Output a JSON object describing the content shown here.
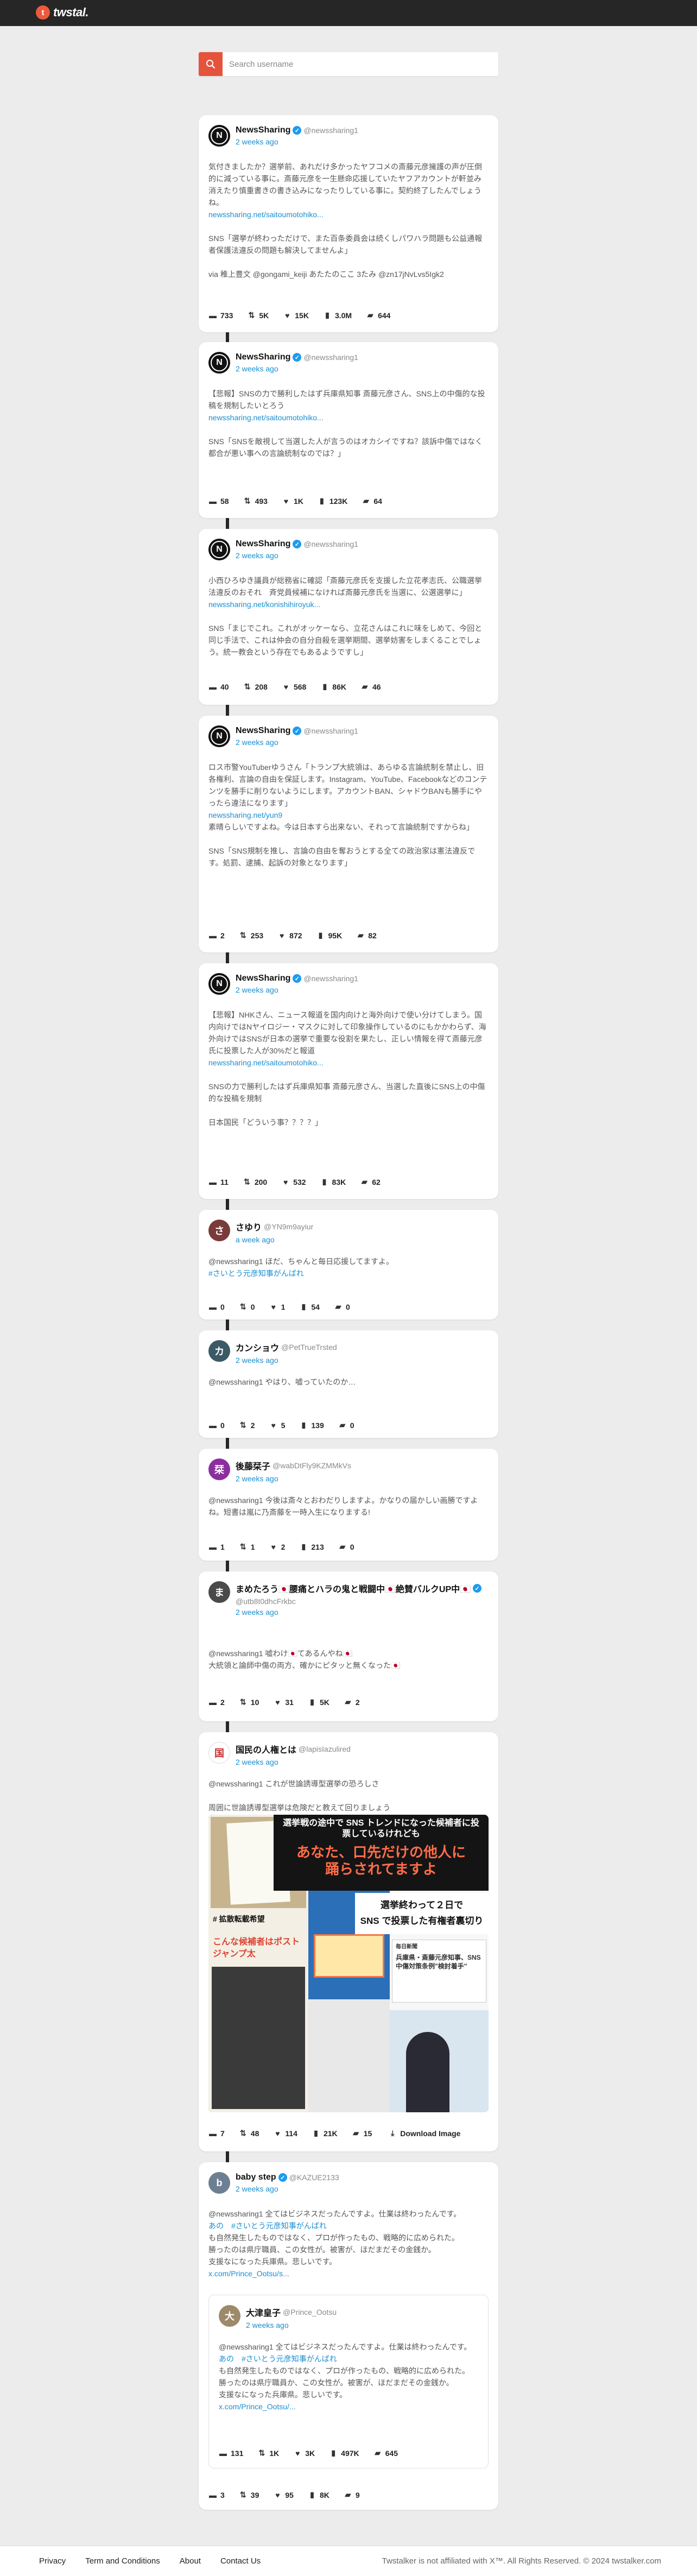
{
  "app": {
    "logo_text": "twstal."
  },
  "search": {
    "placeholder": "Search username"
  },
  "colors": {
    "accent": "#e5533d",
    "link": "#1a8fd1",
    "verified": "#1d9bf0",
    "topbar": "#262626"
  },
  "posts": [
    {
      "name": "NewsSharing",
      "handle": "@newssharing1",
      "time": "2 weeks ago",
      "body": [
        "気付きましたか？選挙前、あれだけ多かったヤフコメの斎藤元彦擁護の声が圧倒的に減っている事に。斎藤元彦を一生懸命応援していたヤフアカウントが軒並み消えたり慎重書きの書き込みになったりしている事に。契約終了したんでしょうね。",
        "newssharing.net/saitoumotohiko...",
        "",
        "SNS「選挙が終わっただけで、また百条委員会は続くしパワハラ問題も公益通報者保護法違反の問題も解決してませんよ」",
        "",
        "via 稚上豊文 @gongami_keiji あたたのここ 3たみ @zn17jNvLvs5Igk2"
      ],
      "stats": {
        "comments": "733",
        "reposts": "5K",
        "likes": "15K",
        "views": "3.0M",
        "bookmarks": "644"
      }
    },
    {
      "name": "NewsSharing",
      "handle": "@newssharing1",
      "time": "2 weeks ago",
      "body": [
        "【悲報】SNSの力で勝利したはず兵庫県知事 斎藤元彦さん、SNS上の中傷的な投稿を規制したいとろう",
        "newssharing.net/saitoumotohiko...",
        "",
        "SNS「SNSを敵視して当選した人が言うのはオカシイですね？該訴中傷ではなく都合が悪い事への言論統制なのでは？」"
      ],
      "stats": {
        "comments": "58",
        "reposts": "493",
        "likes": "1K",
        "views": "123K",
        "bookmarks": "64"
      }
    },
    {
      "name": "NewsSharing",
      "handle": "@newssharing1",
      "time": "2 weeks ago",
      "body": [
        "小西ひろゆき議員が総務省に確認「斎藤元彦氏を支援した立花孝志氏、公職選挙法違反のおそれ　斉党員候補になければ斎藤元彦氏を当選に、公選選挙に」",
        "newssharing.net/konishihiroyuk...",
        "",
        "SNS「まじでこれ。これがオッケーなら、立花さんはこれに味をしめて、今回と同じ手法で、これは仲会の自分自殺を選挙期間、選挙妨害をしまくることでしょう。統一教会という存在でもあるようですし」"
      ],
      "stats": {
        "comments": "40",
        "reposts": "208",
        "likes": "568",
        "views": "86K",
        "bookmarks": "46"
      }
    },
    {
      "name": "NewsSharing",
      "handle": "@newssharing1",
      "time": "2 weeks ago",
      "body": [
        "ロス市警YouTuberゆうさん「トランプ大統領は、あらゆる言論統制を禁止し、旧各権利、言論の自由を保証します。Instagram、YouTube、Facebookなどのコンテンツを勝手に削りないようにします。アカウントBAN、シャドウBANも勝手にやったら違法になります」",
        "newssharing.net/yun9",
        "素晴らしいですよね。今は日本すら出来ない、それって言論統制ですからね」",
        "",
        "SNS「SNS規制を推し、言論の自由を奪おうとする全ての政治家は憲法違反です。処罰、逮捕、起訴の対象となります」"
      ],
      "stats": {
        "comments": "2",
        "reposts": "253",
        "likes": "872",
        "views": "95K",
        "bookmarks": "82"
      }
    },
    {
      "name": "NewsSharing",
      "handle": "@newssharing1",
      "time": "2 weeks ago",
      "body": [
        "【悲報】NHKさん、ニュース報道を国内向けと海外向けで使い分けてしまう。国内向けではNヤイロジー・マスクに対して印象操作しているのにもかかわらず、海外向けではSNSが日本の選挙で重要な役割を果たし、正しい情報を得て斎藤元彦氏に投票した人が30%だと報道",
        "newssharing.net/saitoumotohiko...",
        "",
        "SNSの力で勝利したはず兵庫県知事 斎藤元彦さん、当選した直後にSNS上の中傷的な投稿を規制",
        "",
        "日本国民「どういう事？？？？」"
      ],
      "stats": {
        "comments": "11",
        "reposts": "200",
        "likes": "532",
        "views": "83K",
        "bookmarks": "62"
      }
    },
    {
      "name": "さゆり",
      "handle": "@YN9m9ayiur",
      "time": "a week ago",
      "body": [
        "@newssharing1 ほだ、ちゃんと毎日応援してますよ。",
        "#さいとう元彦知事がんばれ"
      ],
      "stats": {
        "comments": "0",
        "reposts": "0",
        "likes": "1",
        "views": "54",
        "bookmarks": "0"
      }
    },
    {
      "name": "カンショウ",
      "handle": "@PetTrueTrsted",
      "time": "2 weeks ago",
      "body": [
        "@newssharing1 やはり、嘘っていたのか…"
      ],
      "stats": {
        "comments": "0",
        "reposts": "2",
        "likes": "5",
        "views": "139",
        "bookmarks": "0"
      }
    },
    {
      "name": "後藤栞子",
      "handle": "@wabDtFly9KZMMkVs",
      "time": "2 weeks ago",
      "body": [
        "@newssharing1 今後は斎々とおわだりしますよ。かなりの届かしい画勝ですよね。短書は嵐に乃斎藤を一時入生になりまする!"
      ],
      "stats": {
        "comments": "1",
        "reposts": "1",
        "likes": "2",
        "views": "213",
        "bookmarks": "0"
      }
    },
    {
      "name": "まめたろう🇯🇵腰痛とハラの鬼と戦闘中🇯🇵絶賛バルクUP中🇯🇵",
      "handle": "@utb8t0dhcFrkbc",
      "time": "2 weeks ago",
      "body": [
        "@newssharing1 嘘わけ🇯🇵てあるんやね🇯🇵",
        "大統領と論師中傷の両方、確かにピタッと無くなった🇯🇵"
      ],
      "stats": {
        "comments": "2",
        "reposts": "10",
        "likes": "31",
        "views": "5K",
        "bookmarks": "2"
      }
    },
    {
      "name": "国民の人権とは",
      "handle": "@lapisIazulired",
      "time": "2 weeks ago",
      "body": [
        "@newssharing1 これが世論誘導型選挙の恐ろしさ",
        "",
        "周囲に世論誘導型選挙は危険だと教えて回りましょう"
      ],
      "image": {
        "banner_top": "選挙戦の途中で SNS トレンドになった候補者に投票しているけれども",
        "banner_main": "あなた、口先だけの他人に",
        "banner_main2": "踊らされてますよ",
        "tweet_caption": "選挙終わって２日で",
        "tweet_caption2": "SNS で投票した有権者裏切り",
        "hashtag": "# 拡散転載希望",
        "note_line1": "こんな候補者はポスト",
        "note_line2": "ジャンプ太",
        "news_title": "兵庫県・斎藤元彦知事、SNS中傷対策条例\"検討着手\"",
        "source": "毎日新聞"
      },
      "stats": {
        "comments": "7",
        "reposts": "48",
        "likes": "114",
        "views": "21K",
        "bookmarks": "15",
        "download": "Download Image"
      }
    },
    {
      "name": "baby step",
      "handle": "@KAZUE2133",
      "time": "2 weeks ago",
      "body": [
        "@newssharing1 全てはビジネスだったんですよ。仕業は終わったんです。",
        "あの　#さいとう元彦知事がんばれ",
        "も自然発生したものではなく、プロが作ったもの、戦略的に広められた。",
        "勝ったのは県庁職員、この女性が。被害が、ほだまだその金銭か。",
        "支援なになった兵庫県。悲しいです。",
        "x.com/Prince_Ootsu/s..."
      ],
      "quote": {
        "name": "大津皇子",
        "handle": "@Prince_Ootsu",
        "time": "2 weeks ago",
        "body": [
          "@newssharing1 全てはビジネスだったんですよ。仕業は終わったんです。",
          "あの　#さいとう元彦知事がんばれ",
          "も自然発生したものではなく、プロが作ったもの、戦略的に広められた。",
          "勝ったのは県庁職員か、この女性が。被害が、ほだまだその金銭か。",
          "支援なになった兵庫県。悲しいです。",
          "x.com/Prince_Ootsu/..."
        ],
        "stats": {
          "comments": "131",
          "reposts": "1K",
          "likes": "3K",
          "views": "497K",
          "bookmarks": "645"
        }
      },
      "stats": {
        "comments": "3",
        "reposts": "39",
        "likes": "95",
        "views": "8K",
        "bookmarks": "9"
      }
    }
  ],
  "footer": {
    "links": [
      "Privacy",
      "Term and Conditions",
      "About",
      "Contact Us"
    ],
    "copyright": "Twstalker is not affiliated with X™. All Rights Reserved. © 2024 twstalker.com"
  }
}
